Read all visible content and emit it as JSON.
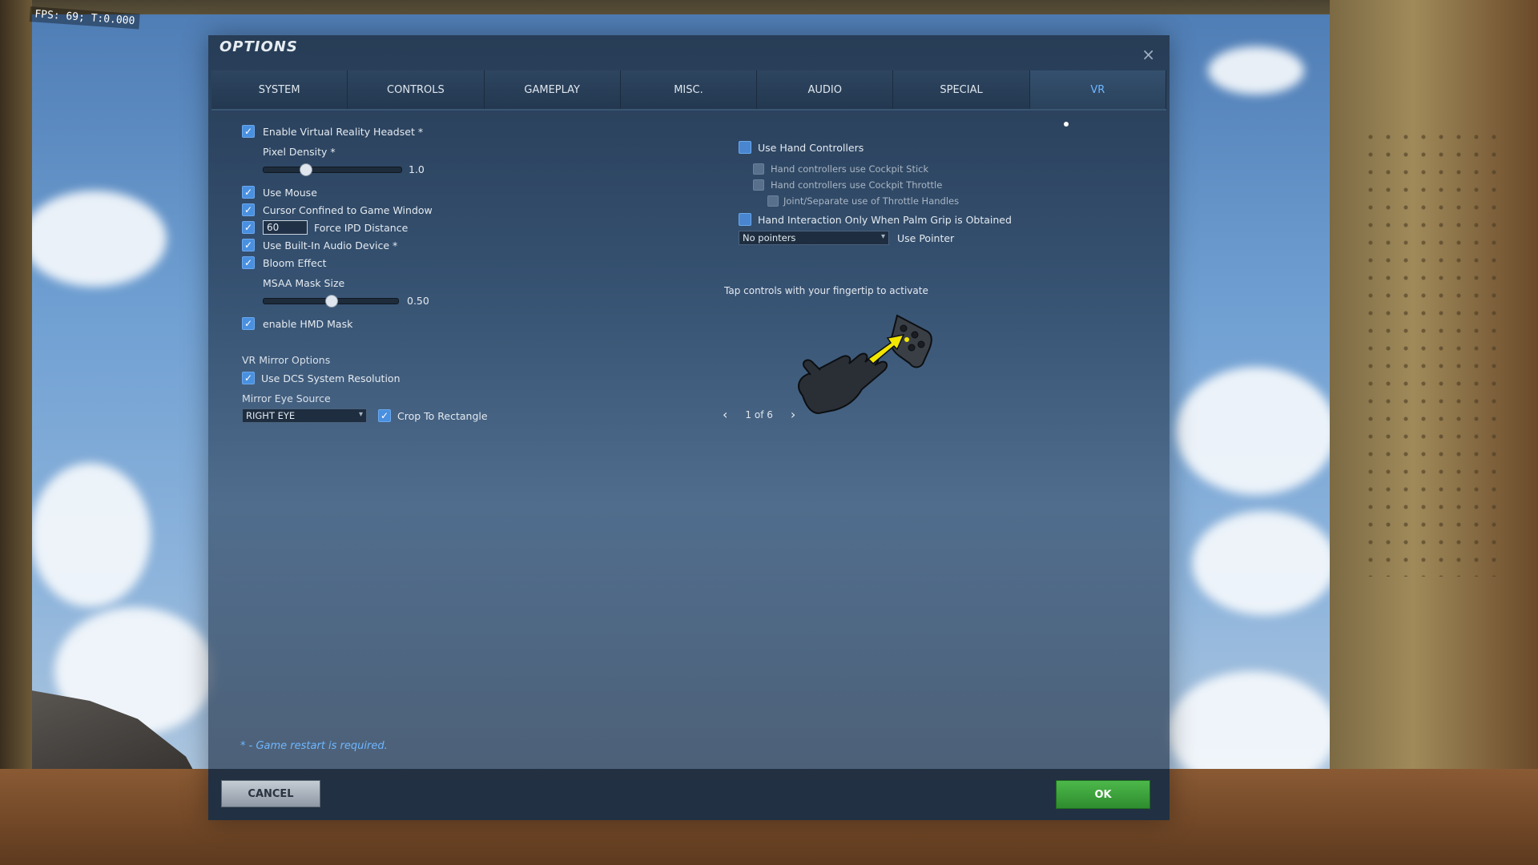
{
  "hud": {
    "fps": "FPS: 69; T:0.000"
  },
  "window": {
    "title": "OPTIONS",
    "close_glyph": "×"
  },
  "tabs": [
    {
      "label": "SYSTEM",
      "active": false
    },
    {
      "label": "CONTROLS",
      "active": false
    },
    {
      "label": "GAMEPLAY",
      "active": false
    },
    {
      "label": "MISC.",
      "active": false
    },
    {
      "label": "AUDIO",
      "active": false
    },
    {
      "label": "SPECIAL",
      "active": false
    },
    {
      "label": "VR",
      "active": true
    }
  ],
  "left": {
    "enable_vr": {
      "label": "Enable Virtual Reality Headset *",
      "checked": true
    },
    "pixel_density": {
      "label": "Pixel Density *",
      "value": "1.0",
      "fraction": 0.3
    },
    "use_mouse": {
      "label": "Use Mouse",
      "checked": true
    },
    "cursor_confined": {
      "label": "Cursor Confined to Game Window",
      "checked": true
    },
    "force_ipd": {
      "label": "Force IPD Distance",
      "checked": true,
      "value": "60"
    },
    "builtin_audio": {
      "label": "Use Built-In Audio Device *",
      "checked": true
    },
    "bloom": {
      "label": "Bloom Effect",
      "checked": true
    },
    "msaa_mask": {
      "label": "MSAA Mask Size",
      "value": "0.50",
      "fraction": 0.5
    },
    "hmd_mask": {
      "label": "enable HMD Mask",
      "checked": true
    },
    "mirror_options_head": "VR Mirror Options",
    "dcs_resolution": {
      "label": "Use DCS System Resolution",
      "checked": true
    },
    "mirror_eye_head": "Mirror Eye Source",
    "mirror_eye_select": "RIGHT EYE",
    "crop_rect": {
      "label": "Crop To Rectangle",
      "checked": true
    }
  },
  "right": {
    "hand_controllers": {
      "label": "Use Hand Controllers",
      "checked": false
    },
    "cockpit_stick": {
      "label": "Hand controllers use Cockpit Stick"
    },
    "cockpit_throttle": {
      "label": "Hand controllers use Cockpit Throttle"
    },
    "throttle_handles": {
      "label": "Joint/Separate use of Throttle Handles"
    },
    "palm_grip": {
      "label": "Hand Interaction Only When Palm Grip is Obtained",
      "checked": false
    },
    "pointer_select": "No pointers",
    "use_pointer": "Use Pointer",
    "hint": "Tap controls with your fingertip to activate",
    "pager": "1 of 6"
  },
  "footer": {
    "restart_note": "* - Game restart is required.",
    "cancel": "CANCEL",
    "ok": "OK"
  },
  "colors": {
    "accent": "#4a90e0",
    "active_tab": "#6fb6ff",
    "ok": "#3aa23a",
    "arrow_highlight": "#f2e600"
  }
}
